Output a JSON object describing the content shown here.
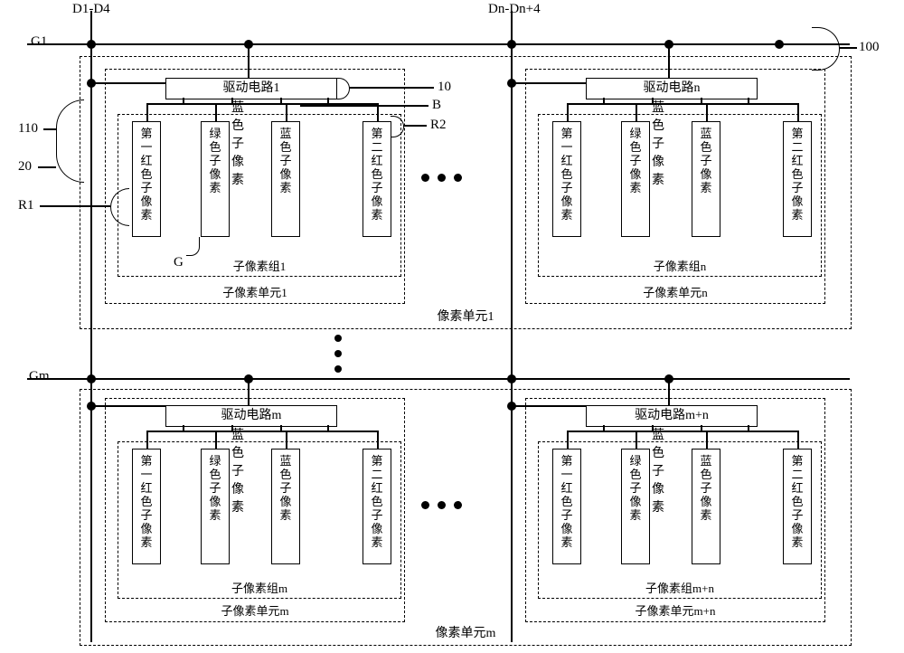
{
  "axis": {
    "g1": "G1",
    "gm": "Gm",
    "d1": "D1-D4",
    "dn": "Dn-Dn+4"
  },
  "callouts": {
    "c100": "100",
    "c10": "10",
    "cB": "B",
    "cR2": "R2",
    "c110": "110",
    "c20": "20",
    "cR1": "R1",
    "cG": "G"
  },
  "pixelUnit": {
    "u1": "像素单元1",
    "um": "像素单元m"
  },
  "subUnit": {
    "s1": "子像素单元1",
    "sn": "子像素单元n",
    "sm": "子像素单元m",
    "smn": "子像素单元m+n"
  },
  "subGroup": {
    "g1": "子像素组1",
    "gn": "子像素组n",
    "gm": "子像素组m",
    "gmn": "子像素组m+n"
  },
  "driver": {
    "d1": "驱动电路1",
    "dn": "驱动电路n",
    "dm": "驱动电路m",
    "dmn": "驱动电路m+n"
  },
  "cells": {
    "r1": [
      "第",
      "一",
      "红",
      "色",
      "子",
      "像",
      "素"
    ],
    "g": [
      "绿",
      "色",
      "子",
      "像",
      "素"
    ],
    "b": [
      "蓝",
      "色",
      "子",
      "像",
      "素"
    ],
    "r2": [
      "第",
      "二",
      "红",
      "色",
      "子",
      "像",
      "素"
    ]
  }
}
